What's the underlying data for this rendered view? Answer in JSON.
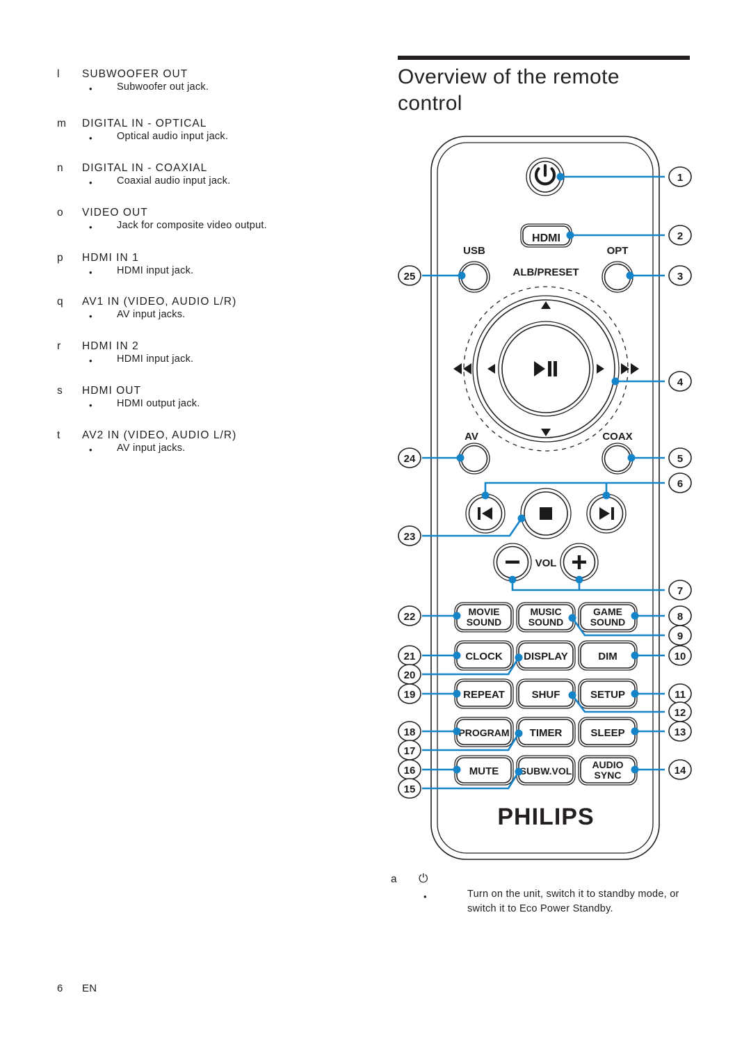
{
  "page": {
    "footer_number": "6",
    "footer_lang": "EN"
  },
  "left_column": {
    "entries": [
      {
        "marker": "l",
        "heading": "SUBWOOFER OUT",
        "bullet": "Subwoofer out jack."
      },
      {
        "marker": "m",
        "heading": "DIGITAL IN - OPTICAL",
        "bullet": "Optical audio input jack."
      },
      {
        "marker": "n",
        "heading": "DIGITAL IN - COAXIAL",
        "bullet": "Coaxial audio input jack."
      },
      {
        "marker": "o",
        "heading": "VIDEO OUT",
        "bullet": "Jack for composite video output."
      },
      {
        "marker": "p",
        "heading": "HDMI IN 1",
        "bullet": "HDMI input jack."
      },
      {
        "marker": "q",
        "heading": "AV1 IN (VIDEO, AUDIO L/R)",
        "bullet": "AV input jacks."
      },
      {
        "marker": "r",
        "heading": "HDMI IN 2",
        "bullet": "HDMI input jack."
      },
      {
        "marker": "s",
        "heading": "HDMI OUT",
        "bullet": "HDMI output jack."
      },
      {
        "marker": "t",
        "heading": "AV2 IN (VIDEO, AUDIO L/R)",
        "bullet": "AV input jacks."
      }
    ]
  },
  "right_column": {
    "title": "Overview of the remote control",
    "caption": {
      "marker": "a",
      "symbol": "⏻",
      "text": "Turn on the unit, switch it to standby mode, or switch it to Eco Power Standby."
    }
  },
  "remote": {
    "brand": "PHILIPS",
    "accent_color": "#1583c8",
    "ink_color": "#231f20",
    "buttons": {
      "power": "⏻",
      "hdmi": "HDMI",
      "usb": "USB",
      "opt": "OPT",
      "alb_preset": "ALB/PRESET",
      "av": "AV",
      "coax": "COAX",
      "play_pause": "▶❙❙",
      "up": "▲",
      "down": "▼",
      "left": "◀",
      "right": "▶",
      "rewind": "◀◀",
      "forward": "▶▶",
      "prev": "⏮",
      "stop": "■",
      "next": "⏭",
      "vol": "VOL",
      "vol_minus": "−",
      "vol_plus": "+",
      "grid": [
        [
          "MOVIE SOUND",
          "MUSIC SOUND",
          "GAME SOUND"
        ],
        [
          "CLOCK",
          "DISPLAY",
          "DIM"
        ],
        [
          "REPEAT",
          "SHUF",
          "SETUP"
        ],
        [
          "PROGRAM",
          "TIMER",
          "SLEEP"
        ],
        [
          "MUTE",
          "SUBW.VOL",
          "AUDIO SYNC"
        ]
      ]
    },
    "callouts_right": [
      "1",
      "2",
      "3",
      "4",
      "5",
      "6",
      "7",
      "8",
      "9",
      "10",
      "11",
      "12",
      "13",
      "14"
    ],
    "callouts_left": [
      "25",
      "24",
      "23",
      "22",
      "21",
      "20",
      "19",
      "18",
      "17",
      "16",
      "15"
    ]
  }
}
